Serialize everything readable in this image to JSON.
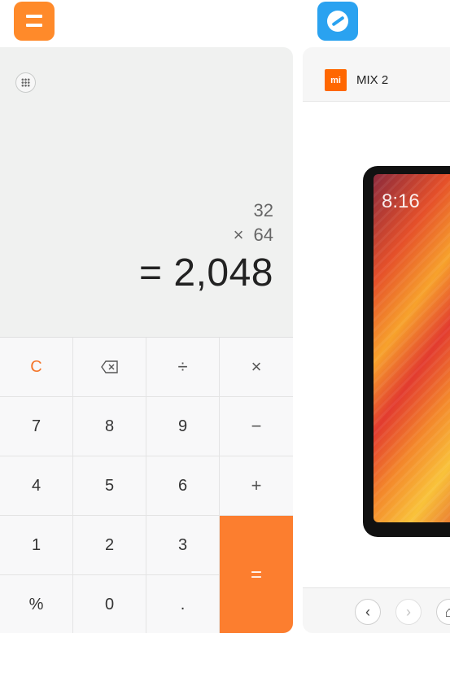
{
  "calculator": {
    "app_icon": "calculator-icon",
    "menu_icon": "grid-dots-icon",
    "expression_line1": "32",
    "expression_operator": "×",
    "expression_line2": "64",
    "result": "= 2,048",
    "keys": [
      [
        "C",
        "⌫",
        "÷",
        "×"
      ],
      [
        "7",
        "8",
        "9",
        "−"
      ],
      [
        "4",
        "5",
        "6",
        "+"
      ],
      [
        "1",
        "2",
        "3",
        "="
      ],
      [
        "%",
        "0",
        ".",
        ""
      ]
    ],
    "accent_color": "#fc7e2f"
  },
  "browser": {
    "app_icon": "browser-icon",
    "tab_logo": "mi",
    "tab_title": "MIX 2",
    "phone_time": "8:16",
    "nav": [
      "back-icon",
      "forward-icon",
      "home-icon"
    ]
  }
}
